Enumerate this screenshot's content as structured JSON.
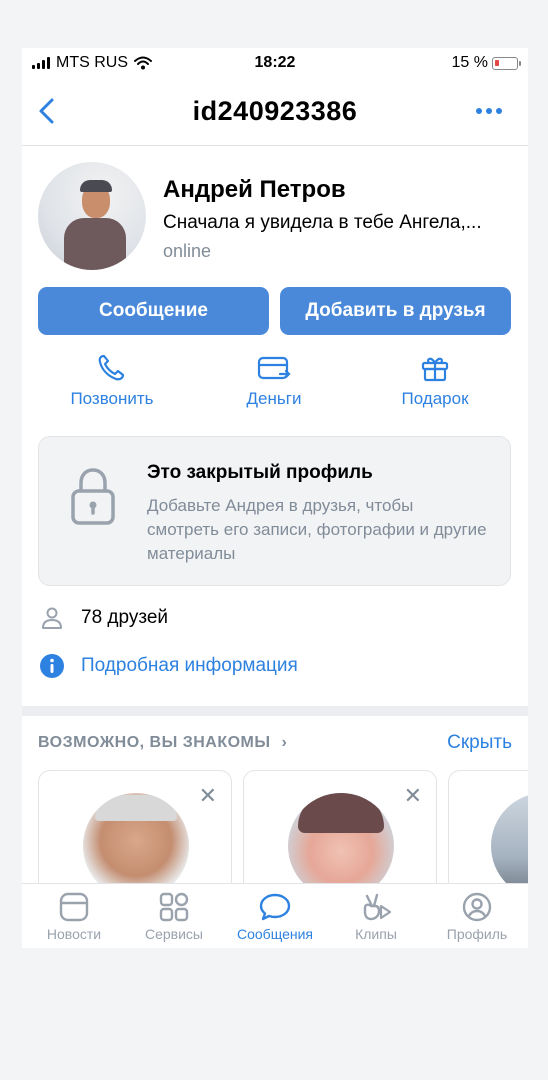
{
  "status_bar": {
    "carrier": "MTS RUS",
    "time": "18:22",
    "battery": "15 %"
  },
  "header": {
    "title": "id240923386"
  },
  "profile": {
    "name": "Андрей Петров",
    "status": "Сначала я увидела в тебе Ангела,...",
    "presence": "online"
  },
  "buttons": {
    "message": "Сообщение",
    "add_friend": "Добавить в друзья"
  },
  "actions": [
    {
      "label": "Позвонить",
      "icon": "phone-icon"
    },
    {
      "label": "Деньги",
      "icon": "money-transfer-icon"
    },
    {
      "label": "Подарок",
      "icon": "gift-icon"
    }
  ],
  "closed_profile": {
    "title": "Это закрытый профиль",
    "text": "Добавьте Андрея в друзья, чтобы смотреть его записи, фотографии и другие материалы"
  },
  "friends": {
    "label": "78 друзей"
  },
  "details": {
    "label": "Подробная информация"
  },
  "suggestions": {
    "heading": "ВОЗМОЖНО, ВЫ ЗНАКОМЫ",
    "hide": "Скрыть"
  },
  "tabbar": [
    {
      "label": "Новости",
      "icon": "news-icon",
      "active": false
    },
    {
      "label": "Сервисы",
      "icon": "services-icon",
      "active": false
    },
    {
      "label": "Сообщения",
      "icon": "messages-icon",
      "active": true
    },
    {
      "label": "Клипы",
      "icon": "clips-icon",
      "active": false
    },
    {
      "label": "Профиль",
      "icon": "profile-icon",
      "active": false
    }
  ],
  "colors": {
    "accent": "#2d81e0",
    "button": "#4a89d9",
    "secondary_text": "#818c99",
    "battery_low": "#e64646"
  }
}
